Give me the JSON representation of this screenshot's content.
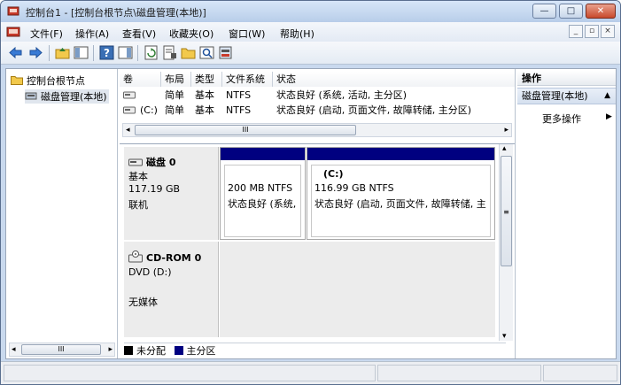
{
  "window": {
    "title": "控制台1 - [控制台根节点\\磁盘管理(本地)]"
  },
  "window_controls": {
    "minimize": "—",
    "maximize": "□",
    "close": "✕"
  },
  "menu": {
    "items": [
      "文件(F)",
      "操作(A)",
      "查看(V)",
      "收藏夹(O)",
      "窗口(W)",
      "帮助(H)"
    ],
    "mdi_controls": [
      "_",
      "▫",
      "×"
    ]
  },
  "tree": {
    "root": "控制台根节点",
    "child": "磁盘管理(本地)"
  },
  "volume_table": {
    "columns": [
      "卷",
      "布局",
      "类型",
      "文件系统",
      "状态"
    ],
    "rows": [
      {
        "volume": "",
        "layout": "简单",
        "type": "基本",
        "fs": "NTFS",
        "status": "状态良好 (系统, 活动, 主分区)"
      },
      {
        "volume": "(C:)",
        "layout": "简单",
        "type": "基本",
        "fs": "NTFS",
        "status": "状态良好 (启动, 页面文件, 故障转储, 主分区)"
      }
    ]
  },
  "scroll": {
    "hthumb_glyph": "III",
    "left_arrow": "◂",
    "right_arrow": "▸",
    "up_arrow": "▴",
    "down_arrow": "▾",
    "vthumb_glyph": "≡"
  },
  "disks": [
    {
      "name": "磁盘 0",
      "type": "基本",
      "size": "117.19 GB",
      "status": "联机",
      "partitions": [
        {
          "title": "",
          "line1": "200 MB NTFS",
          "line2": "状态良好 (系统,"
        },
        {
          "title": "(C:)",
          "line1": "116.99 GB NTFS",
          "line2": "状态良好 (启动, 页面文件, 故障转储, 主"
        }
      ]
    },
    {
      "name": "CD-ROM 0",
      "type": "DVD (D:)",
      "media": "无媒体"
    }
  ],
  "legend": [
    {
      "label": "未分配",
      "color": "#000000"
    },
    {
      "label": "主分区",
      "color": "#000080"
    }
  ],
  "actions": {
    "header": "操作",
    "selected": "磁盘管理(本地)",
    "more": "更多操作"
  },
  "colors": {
    "partition_bar": "#000080",
    "titlebar": "#c9d9ee"
  }
}
